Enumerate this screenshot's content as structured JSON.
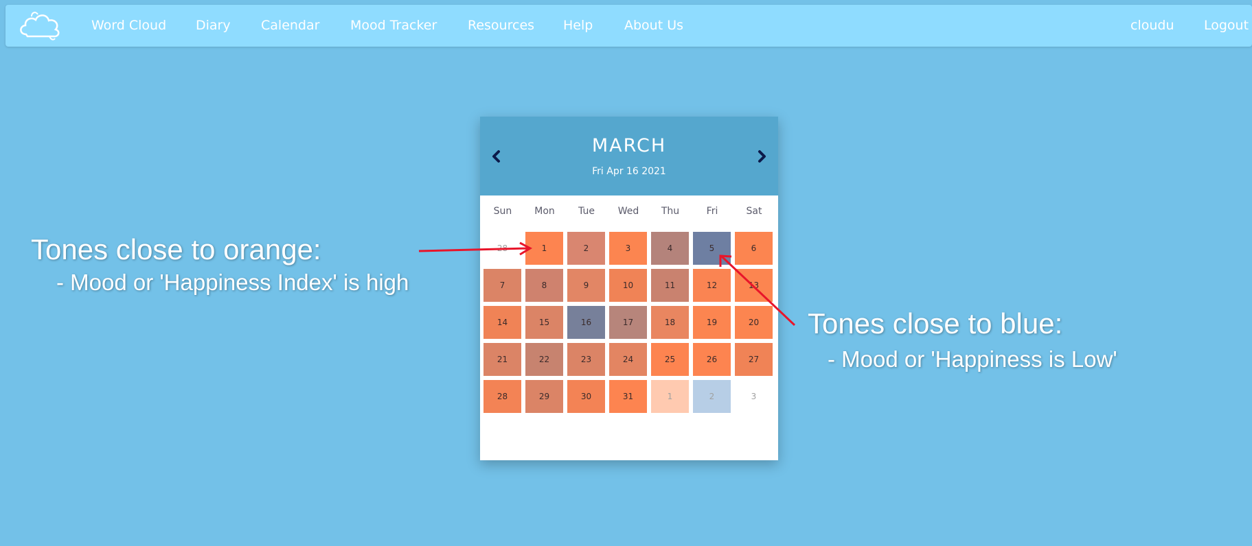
{
  "nav": {
    "logo_icon": "cloud-logo-icon",
    "items": [
      {
        "label": "Word Cloud"
      },
      {
        "label": "Diary"
      },
      {
        "label": "Calendar"
      },
      {
        "label": "Mood Tracker"
      },
      {
        "label": "Resources"
      },
      {
        "label": "Help"
      },
      {
        "label": "About Us"
      }
    ],
    "username": "cloudu",
    "logout": "Logout"
  },
  "calendar": {
    "month": "MARCH",
    "today": "Fri Apr 16 2021",
    "prev_icon": "chevron-left-icon",
    "next_icon": "chevron-right-icon",
    "weekdays": [
      "Sun",
      "Mon",
      "Tue",
      "Wed",
      "Thu",
      "Fri",
      "Sat"
    ],
    "days": [
      {
        "label": "28",
        "color": "#ffffff",
        "faded": true
      },
      {
        "label": "1",
        "color": "#fd8450"
      },
      {
        "label": "2",
        "color": "#d98670"
      },
      {
        "label": "3",
        "color": "#fc8550"
      },
      {
        "label": "4",
        "color": "#b4837b"
      },
      {
        "label": "5",
        "color": "#6e7fa2"
      },
      {
        "label": "6",
        "color": "#fc8550"
      },
      {
        "label": "7",
        "color": "#db8466"
      },
      {
        "label": "8",
        "color": "#cf826e"
      },
      {
        "label": "9",
        "color": "#e28665"
      },
      {
        "label": "10",
        "color": "#f08356"
      },
      {
        "label": "11",
        "color": "#c9826f"
      },
      {
        "label": "12",
        "color": "#fa8452"
      },
      {
        "label": "13",
        "color": "#fc8550"
      },
      {
        "label": "14",
        "color": "#f08356"
      },
      {
        "label": "15",
        "color": "#db8466"
      },
      {
        "label": "16",
        "color": "#77809a"
      },
      {
        "label": "17",
        "color": "#b7857b"
      },
      {
        "label": "18",
        "color": "#e98660"
      },
      {
        "label": "19",
        "color": "#fc8550"
      },
      {
        "label": "20",
        "color": "#fc8550"
      },
      {
        "label": "21",
        "color": "#db8466"
      },
      {
        "label": "22",
        "color": "#c7836f"
      },
      {
        "label": "23",
        "color": "#db8466"
      },
      {
        "label": "24",
        "color": "#e38562"
      },
      {
        "label": "25",
        "color": "#fd8450"
      },
      {
        "label": "26",
        "color": "#fd8450"
      },
      {
        "label": "27",
        "color": "#f08356"
      },
      {
        "label": "28",
        "color": "#f38355"
      },
      {
        "label": "29",
        "color": "#db8466"
      },
      {
        "label": "30",
        "color": "#f38355"
      },
      {
        "label": "31",
        "color": "#fd8450"
      },
      {
        "label": "1",
        "color": "#ffcab0",
        "faded": true
      },
      {
        "label": "2",
        "color": "#b7cee6",
        "faded": true
      },
      {
        "label": "3",
        "color": "#ffffff",
        "faded": true
      }
    ]
  },
  "annotations": {
    "orange_title": "Tones close to orange:",
    "orange_sub": "- Mood or 'Happiness Index' is high",
    "blue_title": "Tones close to blue:",
    "blue_sub": "- Mood or 'Happiness is Low'",
    "arrow_color": "#e8152a"
  }
}
